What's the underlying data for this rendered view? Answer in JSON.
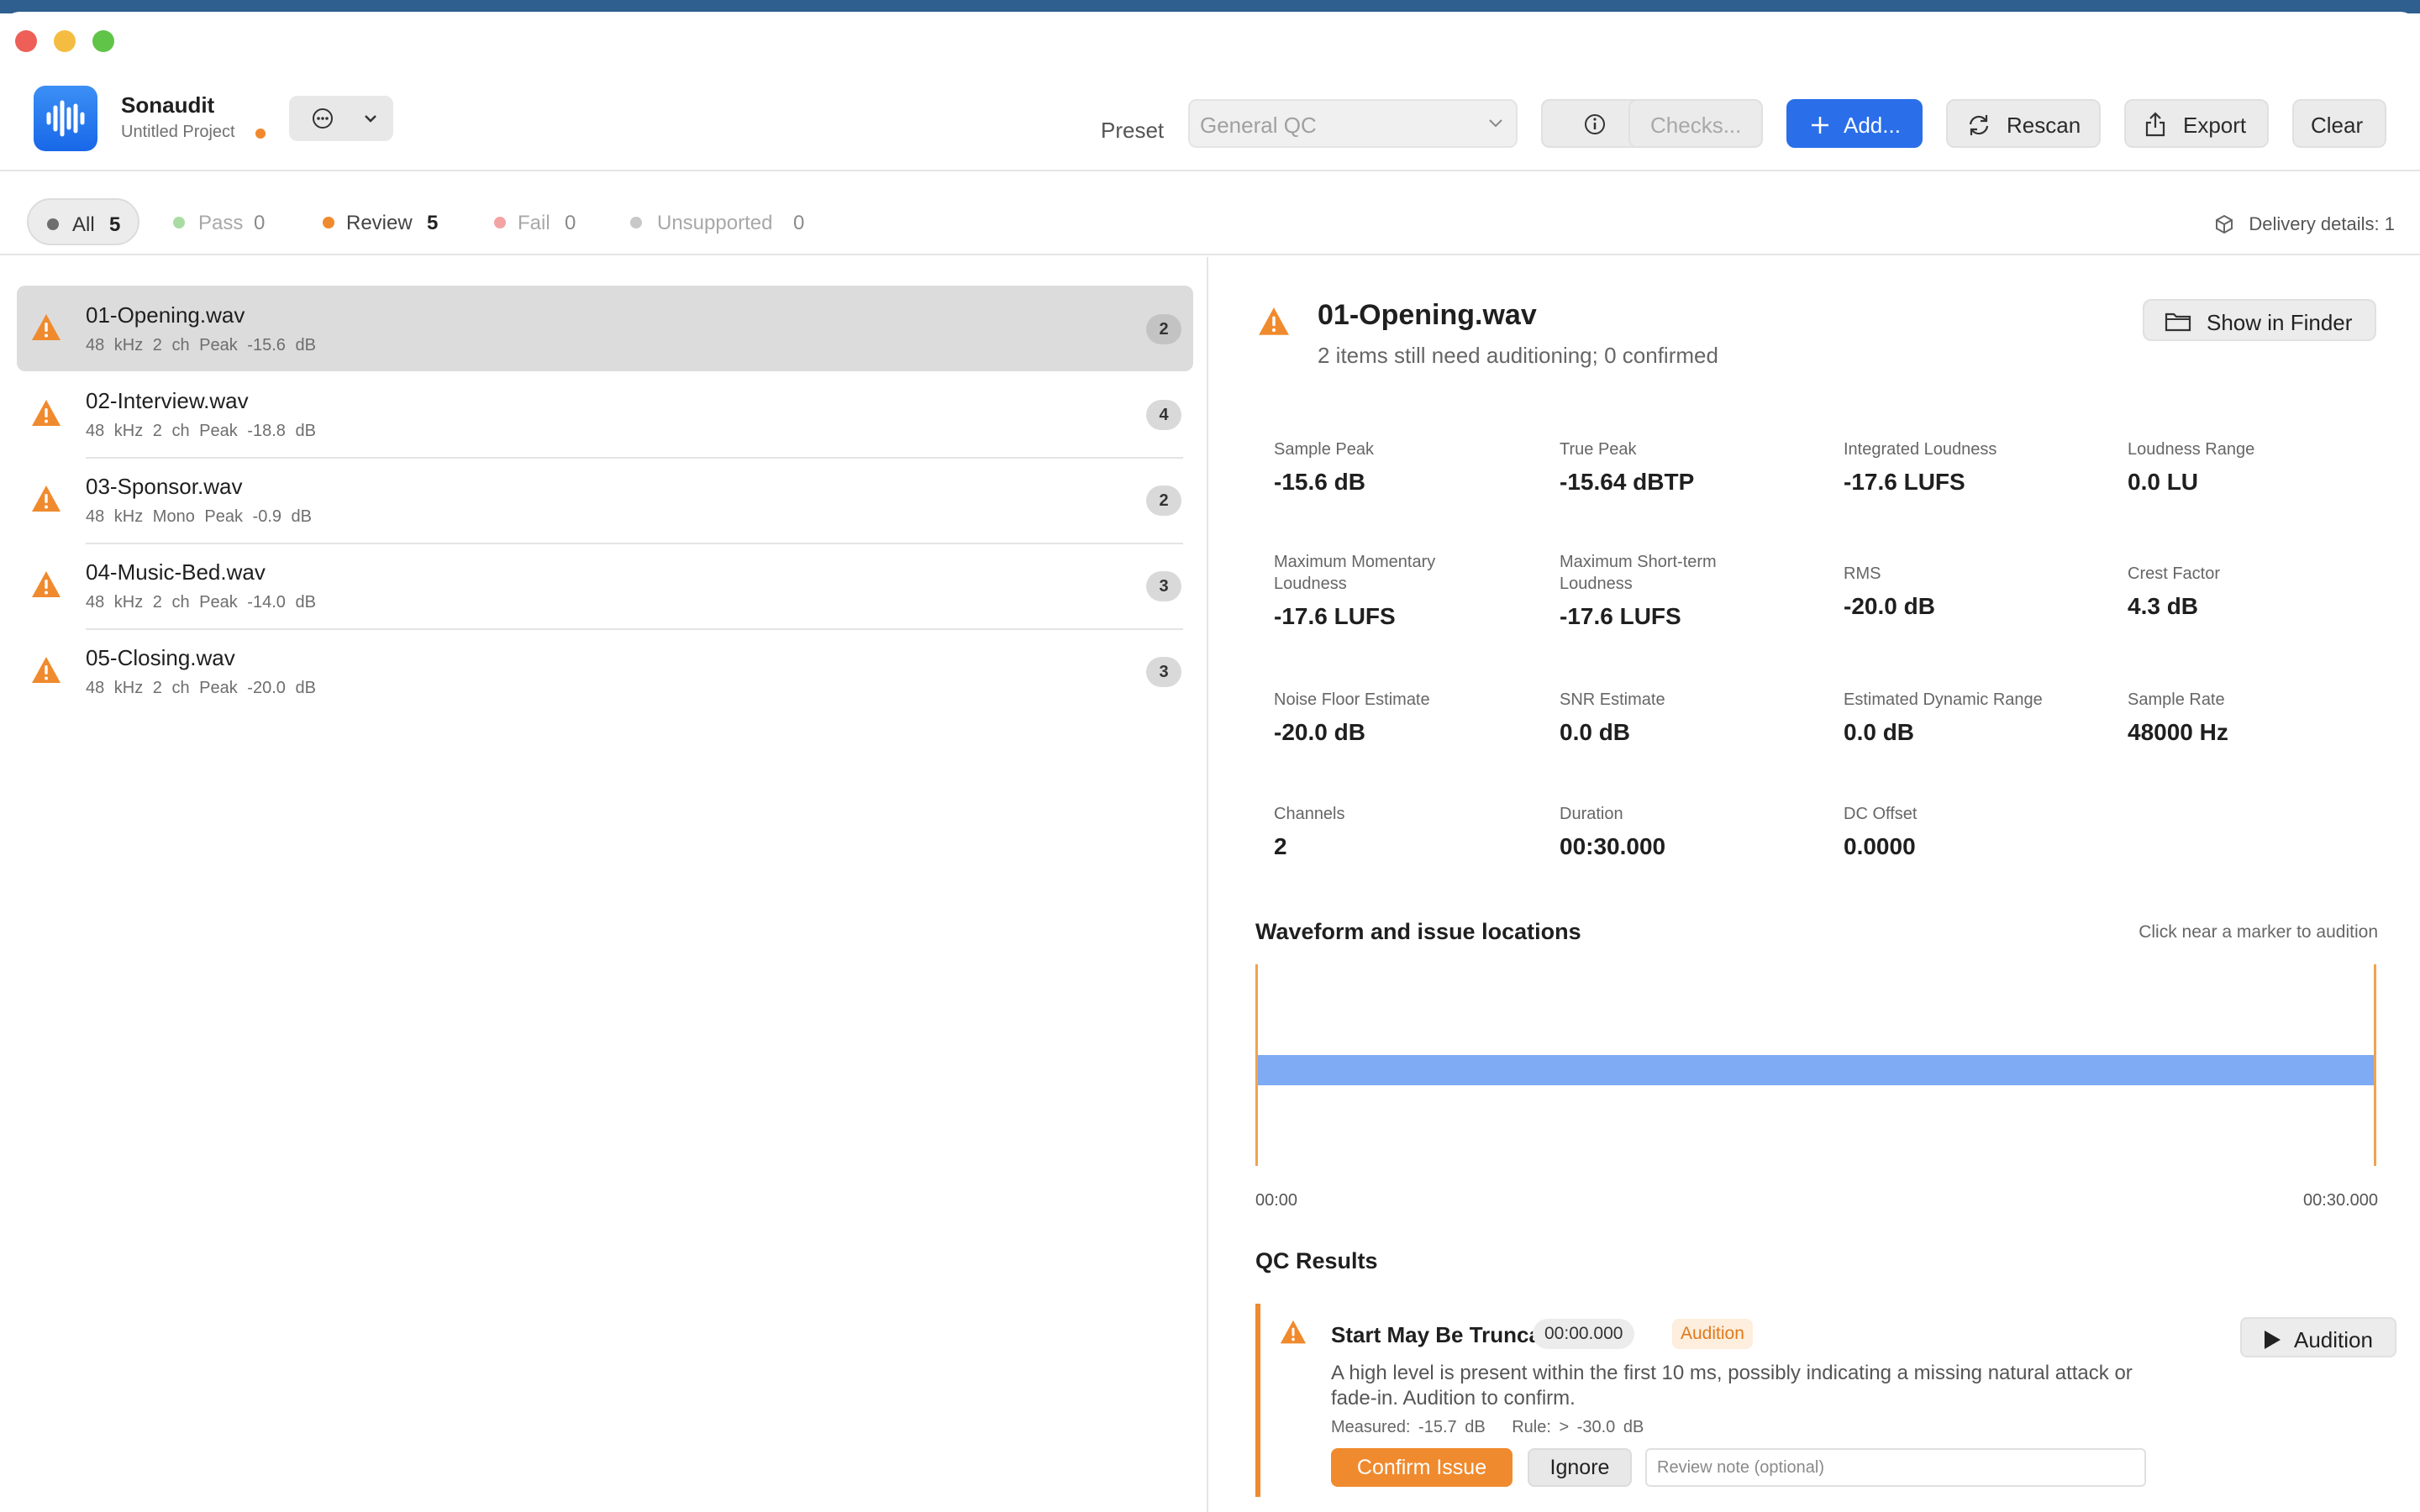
{
  "app": {
    "name": "Sonaudit",
    "project": "Untitled Project"
  },
  "colors": {
    "accent": "#2a6ee9",
    "warning": "#f08a2e",
    "pass": "#a9dca2",
    "fail": "#f4a3a3",
    "unsupported": "#c8c8c8"
  },
  "toolbar": {
    "preset_label": "Preset",
    "preset_value": "General QC",
    "checks_label": "Checks...",
    "add_label": "Add...",
    "rescan_label": "Rescan",
    "export_label": "Export",
    "clear_label": "Clear"
  },
  "filters": [
    {
      "label": "All",
      "count": "5"
    },
    {
      "label": "Pass",
      "count": "0"
    },
    {
      "label": "Review",
      "count": "5"
    },
    {
      "label": "Fail",
      "count": "0"
    },
    {
      "label": "Unsupported",
      "count": "0"
    }
  ],
  "delivery": "Delivery details: 1",
  "files": [
    {
      "name": "01-Opening.wav",
      "meta": "48 kHz   2 ch   Peak -15.6 dB",
      "badge": "2"
    },
    {
      "name": "02-Interview.wav",
      "meta": "48 kHz   2 ch   Peak -18.8 dB",
      "badge": "4"
    },
    {
      "name": "03-Sponsor.wav",
      "meta": "48 kHz   Mono   Peak -0.9 dB",
      "badge": "2"
    },
    {
      "name": "04-Music-Bed.wav",
      "meta": "48 kHz   2 ch   Peak -14.0 dB",
      "badge": "3"
    },
    {
      "name": "05-Closing.wav",
      "meta": "48 kHz   2 ch   Peak -20.0 dB",
      "badge": "3"
    }
  ],
  "detail": {
    "title": "01-Opening.wav",
    "subtitle": "2 items still need auditioning; 0 confirmed",
    "finder_label": "Show in Finder",
    "metrics": [
      {
        "label": "Sample Peak",
        "value": "-15.6 dB"
      },
      {
        "label": "True Peak",
        "value": "-15.64 dBTP"
      },
      {
        "label": "Integrated Loudness",
        "value": "-17.6 LUFS"
      },
      {
        "label": "Loudness Range",
        "value": "0.0 LU"
      },
      {
        "label": "Maximum Momentary Loudness",
        "value": "-17.6 LUFS"
      },
      {
        "label": "Maximum Short-term Loudness",
        "value": "-17.6 LUFS"
      },
      {
        "label": "RMS",
        "value": "-20.0 dB"
      },
      {
        "label": "Crest Factor",
        "value": "4.3 dB"
      },
      {
        "label": "Noise Floor Estimate",
        "value": "-20.0 dB"
      },
      {
        "label": "SNR Estimate",
        "value": "0.0 dB"
      },
      {
        "label": "Estimated Dynamic Range",
        "value": "0.0 dB"
      },
      {
        "label": "Sample Rate",
        "value": "48000 Hz"
      },
      {
        "label": "Channels",
        "value": "2"
      },
      {
        "label": "Duration",
        "value": "00:30.000"
      },
      {
        "label": "DC Offset",
        "value": "0.0000"
      }
    ],
    "waveform": {
      "title": "Waveform and issue locations",
      "hint": "Click near a marker to audition",
      "start": "00:00",
      "end": "00:30.000"
    },
    "qc_title": "QC Results",
    "issue": {
      "title": "Start May Be Truncated",
      "time": "00:00.000",
      "tag": "Audition",
      "description": "A high level is present within the first 10 ms, possibly indicating a missing natural attack or fade-in. Audition to confirm.",
      "measured": "Measured: -15.7 dB",
      "rule": "Rule: > -30.0 dB",
      "confirm_label": "Confirm Issue",
      "ignore_label": "Ignore",
      "note_placeholder": "Review note (optional)",
      "audition_label": "Audition"
    }
  }
}
